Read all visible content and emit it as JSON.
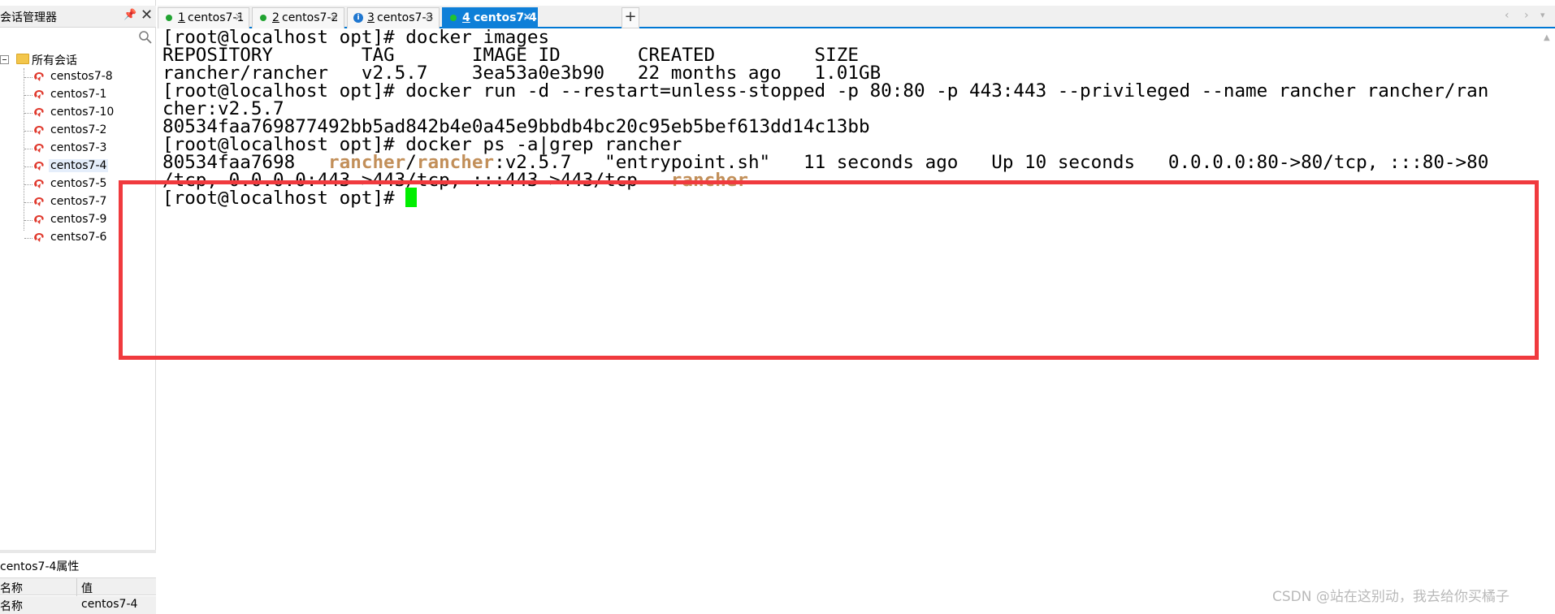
{
  "sidebar": {
    "title": "会话管理器",
    "pin_glyph": "📌",
    "close_glyph": "✕",
    "root_label": "所有会话",
    "items": [
      {
        "label": "censtos7-8"
      },
      {
        "label": "centos7-1"
      },
      {
        "label": "centos7-10"
      },
      {
        "label": "centos7-2"
      },
      {
        "label": "centos7-3"
      },
      {
        "label": "centos7-4",
        "selected": true
      },
      {
        "label": "centos7-5"
      },
      {
        "label": "centos7-7"
      },
      {
        "label": "centos7-9"
      },
      {
        "label": "centso7-6"
      }
    ]
  },
  "properties": {
    "title": "centos7-4属性",
    "header": {
      "name": "名称",
      "value": "值"
    },
    "row": {
      "name": "名称",
      "value": "centos7-4"
    }
  },
  "tabs": [
    {
      "num": "1",
      "name": "centos7-1",
      "status": "green"
    },
    {
      "num": "2",
      "name": "centos7-2",
      "status": "green"
    },
    {
      "num": "3",
      "name": "centos7-3",
      "status": "info"
    },
    {
      "num": "4",
      "name": "centos7-4",
      "status": "green",
      "active": true
    }
  ],
  "tab_controls": {
    "add": "+",
    "prev": "‹",
    "next": "›",
    "menu": "▾"
  },
  "terminal": {
    "lines": [
      "[root@localhost opt]# docker images",
      "REPOSITORY        TAG       IMAGE ID       CREATED         SIZE",
      "rancher/rancher   v2.5.7    3ea53a0e3b90   22 months ago   1.01GB",
      "[root@localhost opt]# docker run -d --restart=unless-stopped -p 80:80 -p 443:443 --privileged --name rancher rancher/ran",
      "cher:v2.5.7",
      "80534faa769877492bb5ad842b4e0a45e9bbdb4bc20c95eb5bef613dd14c13bb",
      "[root@localhost opt]# docker ps -a|grep rancher"
    ],
    "ps_line": {
      "id": "80534faa7698   ",
      "img_a": "rancher",
      "img_slash": "/",
      "img_b": "rancher",
      "rest": ":v2.5.7   \"entrypoint.sh\"   11 seconds ago   Up 10 seconds   0.0.0.0:80->80/tcp, :::80->80"
    },
    "ps_line2": {
      "text": "/tcp, 0.0.0.0:443->443/tcp, :::443->443/tcp   ",
      "name": "rancher"
    },
    "prompt": "[root@localhost opt]# "
  },
  "colors": {
    "grep_highlight": "#c28f59",
    "cursor": "#00ee00",
    "annotation_box": "#f03a3e",
    "active_tab": "#0e7fd8"
  },
  "watermark": "CSDN @站在这别动，我去给你买橘子"
}
